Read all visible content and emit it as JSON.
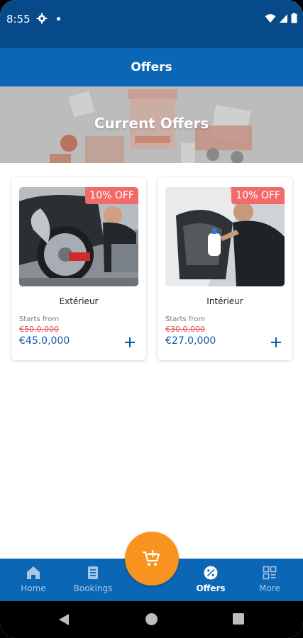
{
  "status_bar": {
    "time": "8:55"
  },
  "app_bar": {
    "title": "Offers"
  },
  "banner": {
    "title": "Current Offers"
  },
  "offers": [
    {
      "badge": "10% OFF",
      "name": "Extérieur",
      "starts_label": "Starts from",
      "old_price": "€50.0,000",
      "new_price": "€45.0,000"
    },
    {
      "badge": "10% OFF",
      "name": "Intérieur",
      "starts_label": "Starts from",
      "old_price": "€30.0,000",
      "new_price": "€27.0,000"
    }
  ],
  "bottom_nav": {
    "home": "Home",
    "bookings": "Bookings",
    "offers": "Offers",
    "more": "More"
  },
  "colors": {
    "status_bar": "#064a8a",
    "app_bar": "#0b67b6",
    "accent_fab": "#f7931e",
    "badge": "#f26a6a",
    "price": "#0b5aa8",
    "old_price": "#e05050"
  },
  "icons": {
    "status": [
      "gear-icon",
      "wifi-icon",
      "signal-icon",
      "battery-icon"
    ],
    "nav": [
      "home-icon",
      "bookings-icon",
      "offers-percent-icon",
      "more-grid-icon"
    ],
    "fab": "cart-add-icon"
  }
}
